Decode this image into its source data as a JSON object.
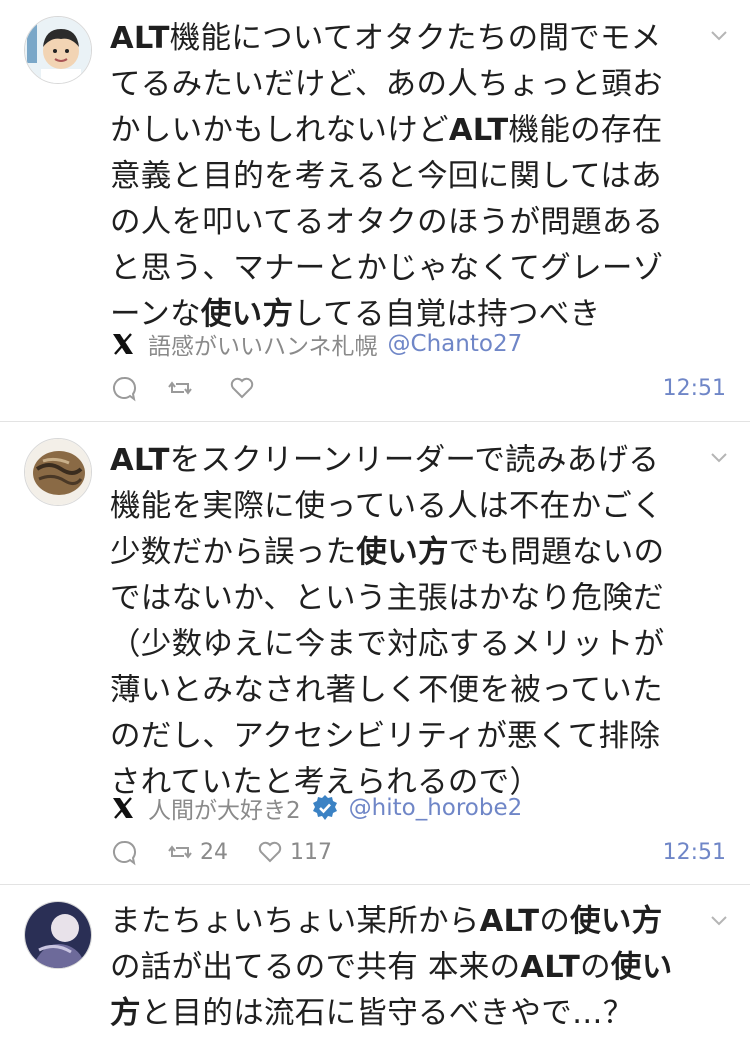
{
  "tweets": [
    {
      "body_segments": [
        {
          "t": "ALT",
          "b": true
        },
        {
          "t": "機能についてオタクたちの間でモメてるみたいだけど、あの人ちょっと頭おかしいかもしれないけど",
          "b": false
        },
        {
          "t": "ALT",
          "b": true
        },
        {
          "t": "機能の存在意義と目的を考えると今回に関してはあの人を叩いてるオタクのほうが問題あると思う、マナーとかじゃなくてグレーゾーンな",
          "b": false
        },
        {
          "t": "使い方",
          "b": true
        },
        {
          "t": "してる自覚は持つべき",
          "b": false
        }
      ],
      "author_name": "語感がいいハンネ札幌",
      "handle": "@Chanto27",
      "verified": false,
      "retweets": "",
      "likes": "",
      "time": "12:51"
    },
    {
      "body_segments": [
        {
          "t": "ALT",
          "b": true
        },
        {
          "t": "をスクリーンリーダーで読みあげる機能を実際に使っている人は不在かごく少数だから誤った",
          "b": false
        },
        {
          "t": "使い方",
          "b": true
        },
        {
          "t": "でも問題ないのではないか、という主張はかなり危険だ（少数ゆえに今まで対応するメリットが薄いとみなされ著しく不便を被っていたのだし、アクセシビリティが悪くて排除されていたと考えられるので）",
          "b": false
        }
      ],
      "author_name": "人間が大好き2",
      "handle": "@hito_horobe2",
      "verified": true,
      "retweets": "24",
      "likes": "117",
      "time": "12:51"
    },
    {
      "body_segments": [
        {
          "t": "またちょいちょい某所から",
          "b": false
        },
        {
          "t": "ALT",
          "b": true
        },
        {
          "t": "の",
          "b": false
        },
        {
          "t": "使い方",
          "b": true
        },
        {
          "t": "の話が出てるので共有 本来の",
          "b": false
        },
        {
          "t": "ALT",
          "b": true
        },
        {
          "t": "の",
          "b": false
        },
        {
          "t": "使い方",
          "b": true
        },
        {
          "t": "と目的は流石に皆守るべきやで…？",
          "b": false
        }
      ]
    }
  ],
  "colors": {
    "link": "#6f86c7",
    "meta": "#8a8a8a",
    "verified": "#3b82c4"
  }
}
